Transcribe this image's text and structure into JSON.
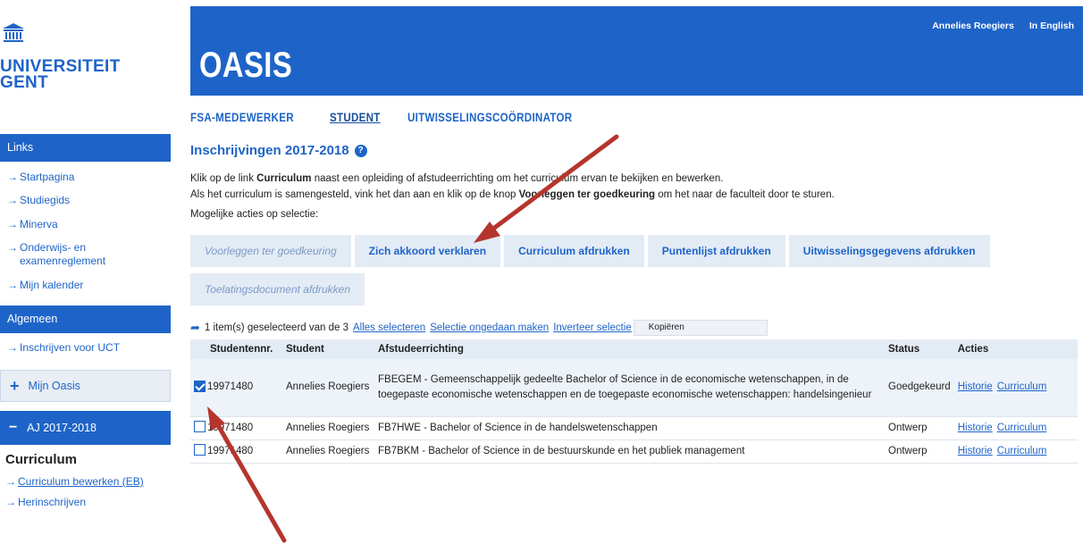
{
  "logo": {
    "line1": "UNIVERSITEIT",
    "line2": "GENT",
    "icon": "university-building-icon"
  },
  "header": {
    "title": "OASIS",
    "user_name": "Annelies Roegiers",
    "language_link": "In English",
    "background_color": "#1e64c8"
  },
  "topnav": {
    "items": [
      {
        "label": "FSA-MEDEWERKER"
      },
      {
        "label": "STUDENT"
      },
      {
        "label": "UITWISSELINGSCOÖRDINATOR"
      }
    ]
  },
  "sidebar": {
    "links_header": "Links",
    "links": [
      {
        "label": "Startpagina"
      },
      {
        "label": "Studiegids"
      },
      {
        "label": "Minerva"
      },
      {
        "label": "Onderwijs- en examenreglement"
      },
      {
        "label": "Mijn kalender"
      }
    ],
    "general_header": "Algemeen",
    "general_links": [
      {
        "label": "Inschrijven voor UCT"
      }
    ],
    "my_oasis": "Mijn Oasis",
    "year_header": "AJ 2017-2018",
    "curriculum_title": "Curriculum",
    "curriculum_links": [
      {
        "label": "Curriculum bewerken (EB)"
      },
      {
        "label": "Herinschrijven"
      }
    ]
  },
  "main": {
    "title": "Inschrijvingen 2017-2018",
    "intro1_pre": "Klik op de link ",
    "intro1_bold": "Curriculum",
    "intro1_post": " naast een opleiding of afstudeerrichting om het curriculum ervan te bekijken en bewerken.",
    "intro2_pre": "Als het curriculum is samengesteld, vink het dan aan en klik op de knop ",
    "intro2_bold": "Voorleggen ter goedkeuring",
    "intro2_post": " om het naar de faculteit door te sturen.",
    "actions_label": "Mogelijke acties op selectie:",
    "buttons": [
      {
        "label": "Voorleggen ter goedkeuring"
      },
      {
        "label": "Zich akkoord verklaren"
      },
      {
        "label": "Curriculum afdrukken"
      },
      {
        "label": "Puntenlijst afdrukken"
      },
      {
        "label": "Uitwisselingsgegevens afdrukken"
      },
      {
        "label": "Toelatingsdocument afdrukken"
      }
    ],
    "selection_text": "1 item(s) geselecteerd van de 3",
    "select_all": "Alles selecteren",
    "undo_selection": "Selectie ongedaan maken",
    "invert_selection": "Inverteer selectie",
    "copy_option": "Kopiëren",
    "columns": [
      "Studentennr.",
      "Student",
      "Afstudeerrichting",
      "Status",
      "Acties"
    ],
    "rows": [
      {
        "number": "19971480",
        "student": "Annelies Roegiers",
        "program": "FBEGEM - Gemeenschappelijk gedeelte Bachelor of Science in de economische wetenschappen, in de toegepaste economische wetenschappen en de toegepaste economische wetenschappen: handelsingenieur",
        "status": "Goedgekeurd",
        "checked": true
      },
      {
        "number": "19971480",
        "student": "Annelies Roegiers",
        "program": "FB7HWE - Bachelor of Science in de handelswetenschappen",
        "status": "Ontwerp",
        "checked": false
      },
      {
        "number": "19971480",
        "student": "Annelies Roegiers",
        "program": "FB7BKM - Bachelor of Science in de bestuurskunde en het publiek management",
        "status": "Ontwerp",
        "checked": false
      }
    ],
    "action_history": "Historie",
    "action_curriculum": "Curriculum"
  },
  "annotation_color": "#b5352c"
}
